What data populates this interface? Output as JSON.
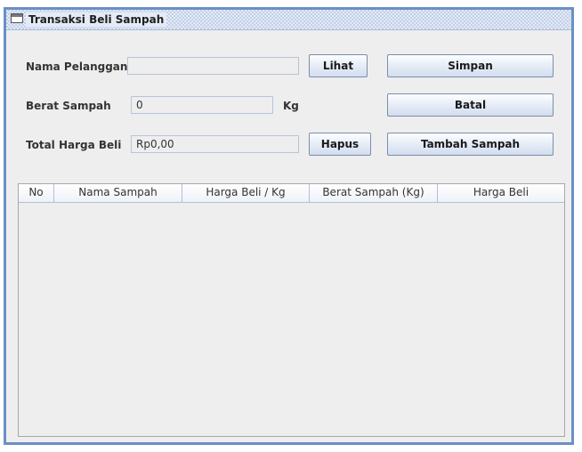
{
  "window": {
    "title": "Transaksi Beli Sampah"
  },
  "form": {
    "nama_pelanggan_label": "Nama Pelanggan",
    "nama_pelanggan_value": "",
    "berat_sampah_label": "Berat Sampah",
    "berat_sampah_value": "0",
    "berat_unit": "Kg",
    "total_harga_label": "Total Harga Beli",
    "total_harga_value": "Rp0,00"
  },
  "buttons": {
    "lihat": "Lihat",
    "simpan": "Simpan",
    "batal": "Batal",
    "hapus": "Hapus",
    "tambah_sampah": "Tambah Sampah"
  },
  "table": {
    "columns": [
      "No",
      "Nama Sampah",
      "Harga Beli / Kg",
      "Berat Sampah (Kg)",
      "Harga Beli"
    ],
    "rows": []
  }
}
